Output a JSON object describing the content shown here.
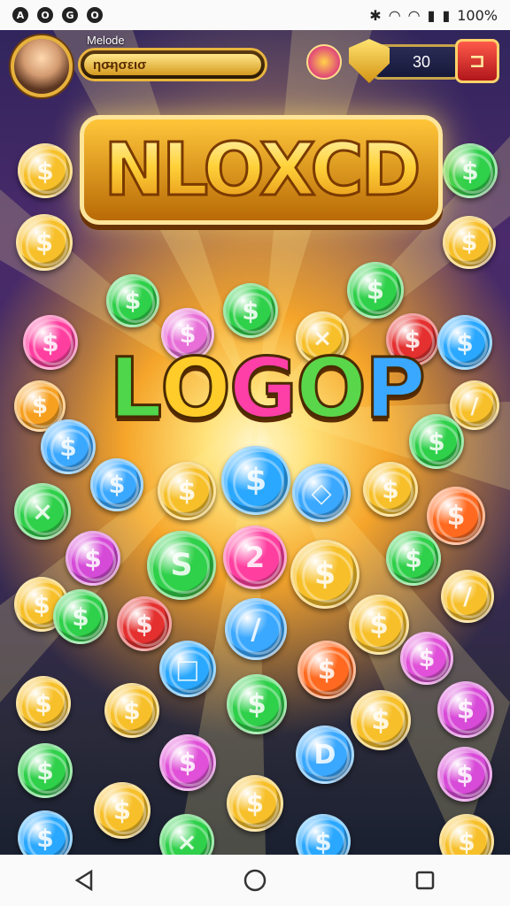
{
  "status_bar": {
    "left_icons": [
      "app-icon-1",
      "app-icon-2",
      "app-icon-3",
      "app-icon-4"
    ],
    "right_icons": [
      "bluetooth-icon",
      "wifi-icon",
      "wifi-icon-2",
      "signal-icon",
      "battery-icon"
    ],
    "battery": "100%"
  },
  "hud": {
    "player_name": "Melode",
    "xp_label": "ησ̶ησεισ",
    "coin_count": "30",
    "colors": {
      "gold": "#e9b53e",
      "shop_red": "#d42020"
    }
  },
  "titles": {
    "main": "NLOXCD",
    "sub": [
      "L",
      "O",
      "G",
      "O",
      "P"
    ],
    "sub_colors": [
      "#4fd64a",
      "#ffcc2a",
      "#ff3fa8",
      "#5ad64a",
      "#3aa8ff"
    ]
  },
  "coins": [
    {
      "c": "#f7c02a",
      "g": "$"
    },
    {
      "c": "#f7c02a",
      "g": "$"
    },
    {
      "c": "#2fd04a",
      "g": "$"
    },
    {
      "c": "#f7c02a",
      "g": "$"
    },
    {
      "c": "#f7c02a",
      "g": "$"
    },
    {
      "c": "#2fd04a",
      "g": "$"
    },
    {
      "c": "#e86fd8",
      "g": "$"
    },
    {
      "c": "#2fd04a",
      "g": "$"
    },
    {
      "c": "#f7c02a",
      "g": "×"
    },
    {
      "c": "#2fd04a",
      "g": "$"
    },
    {
      "c": "#ff3fa0",
      "g": "$"
    },
    {
      "c": "#e53030",
      "g": "$"
    },
    {
      "c": "#2aa8ff",
      "g": "$"
    },
    {
      "c": "#f7a020",
      "g": "$"
    },
    {
      "c": "#3aa8ff",
      "g": "$"
    },
    {
      "c": "#f7c02a",
      "g": "/"
    },
    {
      "c": "#3aa8ff",
      "g": "$"
    },
    {
      "c": "#f7c02a",
      "g": "$"
    },
    {
      "c": "#2aa8ff",
      "g": "$"
    },
    {
      "c": "#3aa8ff",
      "g": "◇"
    },
    {
      "c": "#f7c02a",
      "g": "$"
    },
    {
      "c": "#2fd04a",
      "g": "$"
    },
    {
      "c": "#2fd04a",
      "g": "×"
    },
    {
      "c": "#ff6a20",
      "g": "$"
    },
    {
      "c": "#d64ad8",
      "g": "$"
    },
    {
      "c": "#2fd04a",
      "g": "S"
    },
    {
      "c": "#ff3fa0",
      "g": "2"
    },
    {
      "c": "#f7c02a",
      "g": "$"
    },
    {
      "c": "#2fd04a",
      "g": "$"
    },
    {
      "c": "#f7c02a",
      "g": "$"
    },
    {
      "c": "#2fd04a",
      "g": "$"
    },
    {
      "c": "#e53030",
      "g": "$"
    },
    {
      "c": "#3aa8ff",
      "g": "/"
    },
    {
      "c": "#f7c02a",
      "g": "$"
    },
    {
      "c": "#f7c02a",
      "g": "/"
    },
    {
      "c": "#2aa8ff",
      "g": "□"
    },
    {
      "c": "#ff6a20",
      "g": "$"
    },
    {
      "c": "#e050d8",
      "g": "$"
    },
    {
      "c": "#f7c02a",
      "g": "$"
    },
    {
      "c": "#f7c02a",
      "g": "$"
    },
    {
      "c": "#2fd04a",
      "g": "$"
    },
    {
      "c": "#f7c02a",
      "g": "$"
    },
    {
      "c": "#d84ad8",
      "g": "$"
    },
    {
      "c": "#2fd04a",
      "g": "$"
    },
    {
      "c": "#e050d8",
      "g": "$"
    },
    {
      "c": "#3aa8ff",
      "g": "D"
    },
    {
      "c": "#d84ad8",
      "g": "$"
    },
    {
      "c": "#2aa8ff",
      "g": "$"
    },
    {
      "c": "#f7c02a",
      "g": "$"
    },
    {
      "c": "#2fd04a",
      "g": "×"
    },
    {
      "c": "#f7c02a",
      "g": "$"
    },
    {
      "c": "#2aa8ff",
      "g": "$"
    },
    {
      "c": "#f7c02a",
      "g": "$"
    }
  ],
  "nav": {
    "back": "back-button",
    "home": "home-button",
    "recents": "recents-button"
  }
}
